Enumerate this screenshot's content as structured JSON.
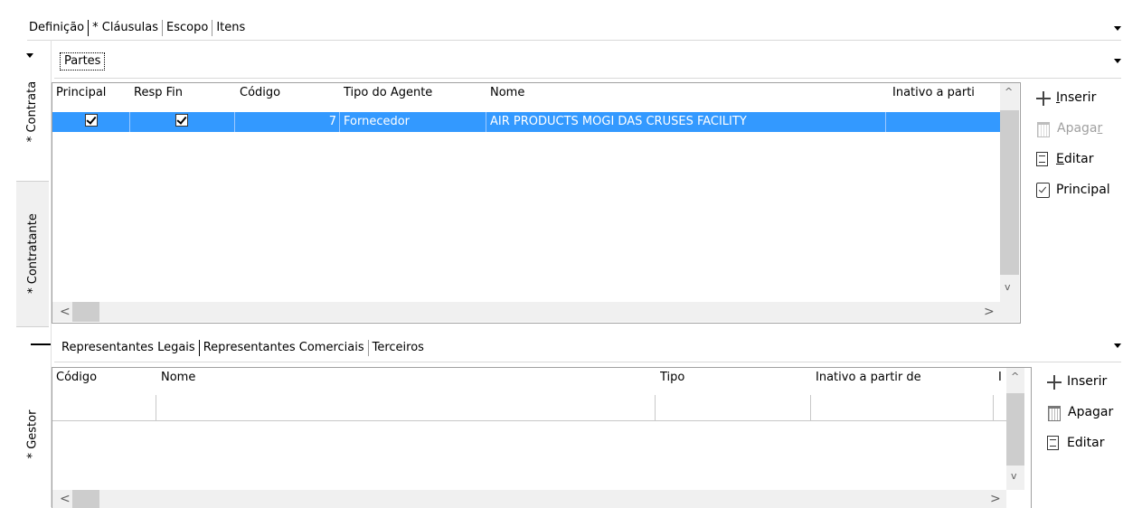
{
  "top_tabs": [
    "Definição",
    "* Cláusulas",
    "Escopo",
    "Itens"
  ],
  "side_tabs": {
    "contrata": "* Contrata",
    "contratante": "* Contratante",
    "gestor": "* Gestor"
  },
  "partes": {
    "tab_label": "Partes",
    "columns": [
      "Principal",
      "Resp Fin",
      "Código",
      "Tipo do Agente",
      "Nome",
      "Inativo a parti"
    ],
    "rows": [
      {
        "principal": true,
        "resp_fin": true,
        "codigo": "7",
        "tipo": "Fornecedor",
        "nome": "AIR PRODUCTS MOGI DAS CRUSES FACILITY",
        "inativo": ""
      }
    ],
    "actions": {
      "inserir": {
        "pre": "",
        "u": "I",
        "post": "nserir"
      },
      "apagar": {
        "pre": "Apaga",
        "u": "r",
        "post": ""
      },
      "editar": {
        "pre": "",
        "u": "E",
        "post": "ditar"
      },
      "principal": "Principal"
    }
  },
  "representantes": {
    "tabs": [
      "Representantes Legais",
      "Representantes Comerciais",
      "Terceiros"
    ],
    "columns": [
      "Código",
      "Nome",
      "Tipo",
      "Inativo a partir de",
      "I"
    ],
    "actions": {
      "inserir": "Inserir",
      "apagar": "Apagar",
      "editar": "Editar"
    }
  },
  "colors": {
    "selection": "#3399ff",
    "border": "#a0a0a0"
  }
}
